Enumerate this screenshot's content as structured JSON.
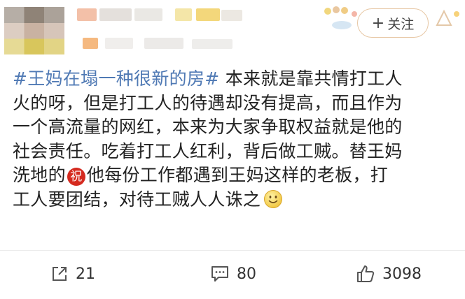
{
  "post": {
    "hashtag": "#王妈在塌一种很新的房#",
    "line1_rest": "本来就是靠共情打工人",
    "line2": "火的呀，但是打工人的待遇却没有提高，而且作为",
    "line3": "一个高流量的网红，本来为大家争取权益就是他的",
    "line4": "社会责任。吃着打工人红利，背后做工贼。替王妈",
    "line5_a": "洗地的",
    "blessing_glyph": "祝",
    "line5_b": "他每份工作都遇到王妈这样的老板，打",
    "line6": "工人要团结，对待工贼人人诛之"
  },
  "header": {
    "follow_plus": "+",
    "follow_label": "关注"
  },
  "actions": {
    "repost_count": "21",
    "comment_count": "80",
    "like_count": "3098"
  },
  "icons": {
    "repost": "share-icon",
    "comment": "comment-icon",
    "like": "thumbs-up-icon",
    "emoji": "smile-emoji-icon",
    "blessing": "blessing-emoji-icon"
  },
  "colors": {
    "hashtag": "#4f79b4",
    "follow_border": "#e7c7a4",
    "blessing_bg": "#d52a1f",
    "text": "#222222"
  }
}
